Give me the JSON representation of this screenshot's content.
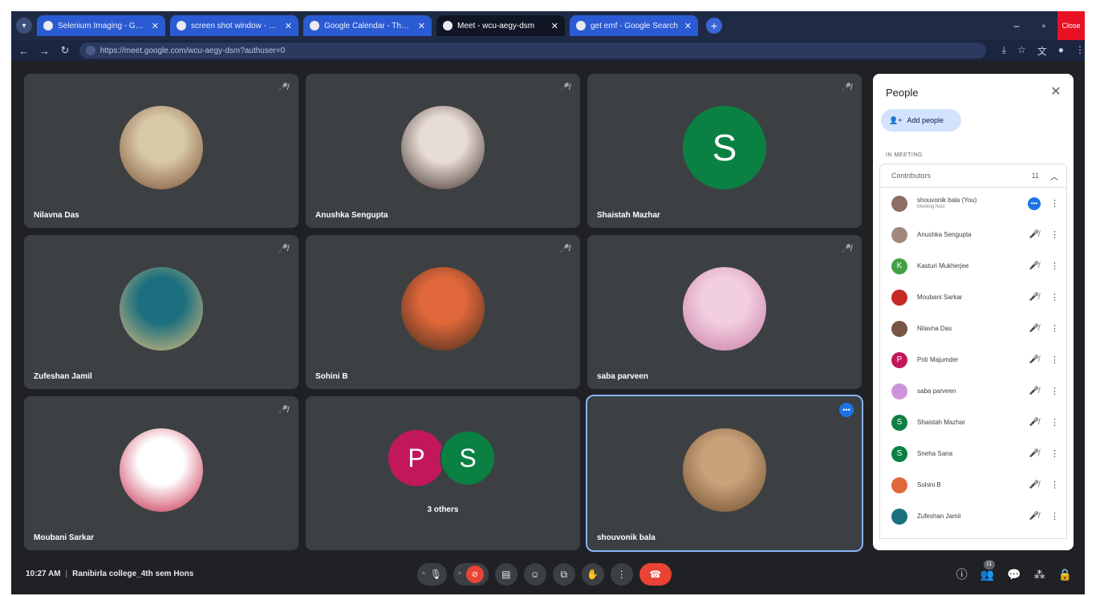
{
  "browser": {
    "tabs": [
      {
        "label": "Selenium Imaging - Google Se...",
        "active": false
      },
      {
        "label": "screen shot window - Google...",
        "active": false
      },
      {
        "label": "Google Calendar - Thursday M...",
        "active": false
      },
      {
        "label": "Meet - wcu-aegy-dsm",
        "active": true
      },
      {
        "label": "get emf - Google Search",
        "active": false
      }
    ],
    "url": "https://meet.google.com/wcu-aegy-dsm?authuser=0",
    "close_tooltip": "Close"
  },
  "tiles": [
    {
      "name": "Nilavna Das",
      "avatar": "photo",
      "colors": [
        "#d7c8a8",
        "#7a4a2f"
      ]
    },
    {
      "name": "Anushka Sengupta",
      "avatar": "photo",
      "colors": [
        "#e8dcd6",
        "#3b2a24"
      ]
    },
    {
      "name": "Shaistah Mazhar",
      "avatar": "letter",
      "letter": "S",
      "colors": [
        "#0b8043"
      ]
    },
    {
      "name": "Zufeshan Jamil",
      "avatar": "photo",
      "colors": [
        "#1b6f7f",
        "#e5c07b"
      ]
    },
    {
      "name": "Sohini B",
      "avatar": "photo",
      "colors": [
        "#e0673a",
        "#3e2a1e"
      ]
    },
    {
      "name": "saba parveen",
      "avatar": "photo",
      "colors": [
        "#f2cfe0",
        "#c77aa3"
      ]
    },
    {
      "name": "Moubani Sarkar",
      "avatar": "photo",
      "colors": [
        "#ffffff",
        "#c2183b"
      ]
    },
    {
      "name": "",
      "avatar": "duo",
      "letters": [
        "P",
        "S"
      ],
      "caption": "3 others"
    },
    {
      "name": "shouvonik bala",
      "avatar": "photo",
      "colors": [
        "#c9a27a",
        "#6b4a2b"
      ],
      "speaking": true
    }
  ],
  "people": {
    "title": "People",
    "add_label": "Add people",
    "in_meeting_label": "IN MEETING",
    "section_label": "Contributors",
    "section_count": "11",
    "list": [
      {
        "name": "shouvonik bala (You)",
        "sub": "Meeting host",
        "color": "#8d6e63",
        "letter": "",
        "status": "speaking"
      },
      {
        "name": "Anushka Sengupta",
        "sub": "",
        "color": "#a1887f",
        "letter": "",
        "status": "muted"
      },
      {
        "name": "Kasturi Mukherjee",
        "sub": "",
        "color": "#43a047",
        "letter": "K",
        "status": "muted"
      },
      {
        "name": "Moubani Sarkar",
        "sub": "",
        "color": "#c62828",
        "letter": "",
        "status": "muted"
      },
      {
        "name": "Nilavna Das",
        "sub": "",
        "color": "#795548",
        "letter": "",
        "status": "muted"
      },
      {
        "name": "Priti Majumder",
        "sub": "",
        "color": "#c2185b",
        "letter": "P",
        "status": "muted"
      },
      {
        "name": "saba parveen",
        "sub": "",
        "color": "#ce93d8",
        "letter": "",
        "status": "muted"
      },
      {
        "name": "Shaistah Mazhar",
        "sub": "",
        "color": "#0b8043",
        "letter": "S",
        "status": "muted"
      },
      {
        "name": "Sneha Sana",
        "sub": "",
        "color": "#0b8043",
        "letter": "S",
        "status": "muted"
      },
      {
        "name": "Sohini B",
        "sub": "",
        "color": "#e0673a",
        "letter": "",
        "status": "muted"
      },
      {
        "name": "Zufeshan Jamil",
        "sub": "",
        "color": "#1b6f7f",
        "letter": "",
        "status": "muted"
      }
    ]
  },
  "meeting": {
    "time": "10:27 AM",
    "title": "Ranibirla college_4th sem Hons",
    "participant_count": "11"
  },
  "colors": {
    "background": "#202124",
    "tile": "#3c4043",
    "accent": "#1a73e8",
    "danger": "#ea4335"
  }
}
